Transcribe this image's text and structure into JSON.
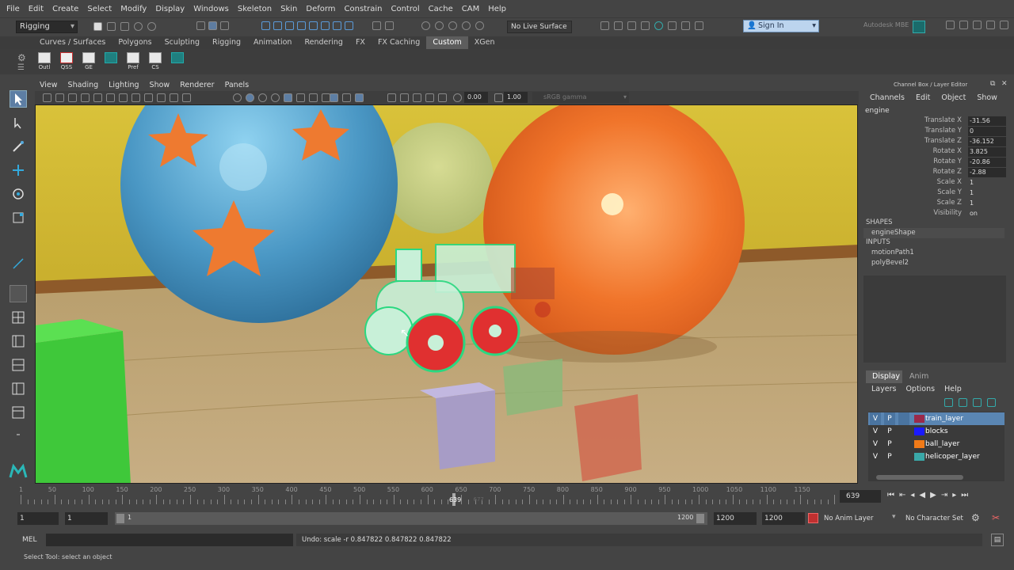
{
  "menu": [
    "File",
    "Edit",
    "Create",
    "Select",
    "Modify",
    "Display",
    "Windows",
    "Skeleton",
    "Skin",
    "Deform",
    "Constrain",
    "Control",
    "Cache",
    "CAM",
    "Help"
  ],
  "status": {
    "mode": "Rigging",
    "live_surface": "No Live Surface",
    "sign_in": "Sign In",
    "brand": "Autodesk MBE"
  },
  "shelf_tabs": [
    "Curves / Surfaces",
    "Polygons",
    "Sculpting",
    "Rigging",
    "Animation",
    "Rendering",
    "FX",
    "FX Caching",
    "Custom",
    "XGen"
  ],
  "shelf_buttons": [
    "Outl",
    "QSS",
    "GE",
    "",
    "Pref",
    "CS",
    ""
  ],
  "panel_menu": [
    "View",
    "Shading",
    "Lighting",
    "Show",
    "Renderer",
    "Panels"
  ],
  "panel_toolbar": {
    "exposure": "0.00",
    "gamma": "1.00",
    "colorspace": "sRGB gamma"
  },
  "channel_box": {
    "title": "Channel Box / Layer Editor",
    "tabs": [
      "Channels",
      "Edit",
      "Object",
      "Show"
    ],
    "object": "engine",
    "attrs": [
      {
        "name": "Translate X",
        "value": "-31.56"
      },
      {
        "name": "Translate Y",
        "value": "0"
      },
      {
        "name": "Translate Z",
        "value": "-36.152"
      },
      {
        "name": "Rotate X",
        "value": "3.825"
      },
      {
        "name": "Rotate Y",
        "value": "-20.86"
      },
      {
        "name": "Rotate Z",
        "value": "-2.88"
      },
      {
        "name": "Scale X",
        "value": "1"
      },
      {
        "name": "Scale Y",
        "value": "1"
      },
      {
        "name": "Scale Z",
        "value": "1"
      },
      {
        "name": "Visibility",
        "value": "on"
      }
    ],
    "shapes_header": "SHAPES",
    "shape": "engineShape",
    "inputs_header": "INPUTS",
    "inputs": [
      "motionPath1",
      "polyBevel2"
    ]
  },
  "layer_editor": {
    "tabs": [
      "Display",
      "Anim"
    ],
    "menu": [
      "Layers",
      "Options",
      "Help"
    ],
    "layers": [
      {
        "v": "V",
        "p": "P",
        "name": "train_layer",
        "color": "#9b2a4a"
      },
      {
        "v": "V",
        "p": "P",
        "name": "blocks",
        "color": "#1a1aff"
      },
      {
        "v": "V",
        "p": "P",
        "name": "ball_layer",
        "color": "#f07a18"
      },
      {
        "v": "V",
        "p": "P",
        "name": "helicoper_layer",
        "color": "#3aa8a8"
      }
    ]
  },
  "timeline": {
    "ticks": [
      "50",
      "100",
      "150",
      "200",
      "250",
      "300",
      "350",
      "400",
      "450",
      "500",
      "550",
      "600",
      "650",
      "700",
      "750",
      "800",
      "850",
      "900",
      "950",
      "1000",
      "1050",
      "1100",
      "1150"
    ],
    "tick_zero": "1",
    "current": "639",
    "current_label": "639",
    "ghost": "677",
    "frame_field": "639"
  },
  "range": {
    "start": "1",
    "playback_start": "1",
    "slider_start": "1",
    "slider_end": "1200",
    "playback_end": "1200",
    "end": "1200",
    "anim_layer": "No Anim Layer",
    "char_set": "No Character Set"
  },
  "command": {
    "lang": "MEL",
    "result": "Undo: scale -r 0.847822 0.847822 0.847822"
  },
  "help_line": "Select Tool: select an object"
}
